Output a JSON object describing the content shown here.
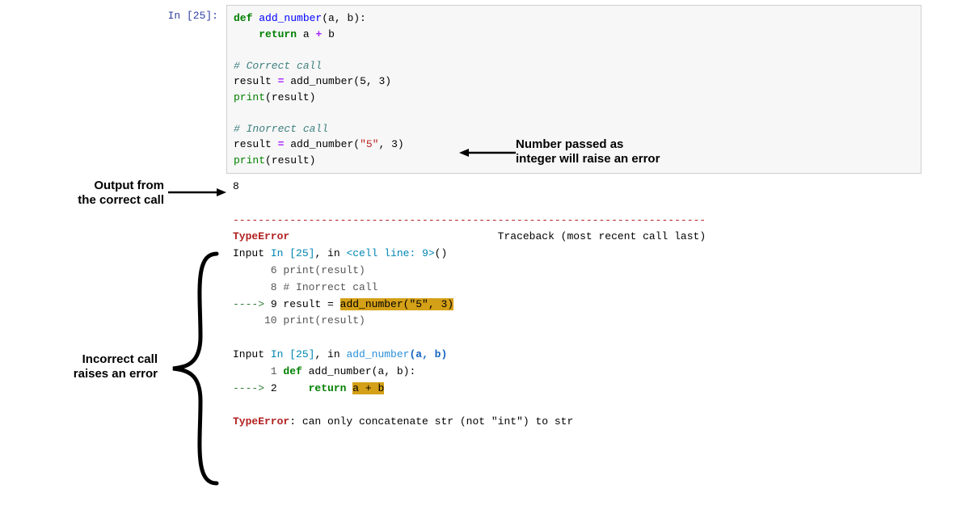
{
  "prompt": {
    "label": "In [25]:"
  },
  "code": {
    "def": "def",
    "func_name": "add_number",
    "params": "(a, b):",
    "return_kw": "return",
    "return_expr_a": "a",
    "return_op": "+",
    "return_expr_b": "b",
    "comment1": "# Correct call",
    "assign1": "result",
    "eq": "=",
    "call1_fn": "add_number",
    "call1_args": "(5, 3)",
    "print1": "print",
    "print1_args": "(result)",
    "comment2": "# Inorrect call",
    "assign2": "result",
    "call2_fn": "add_number",
    "call2_open": "(",
    "call2_str": "\"5\"",
    "call2_rest": ", 3)",
    "print2": "print",
    "print2_args": "(result)"
  },
  "output": {
    "correct_value": "8",
    "sep": "---------------------------------------------------------------------------",
    "err_type": "TypeError",
    "traceback_label": "Traceback (most recent call last)",
    "trace1_input": "Input",
    "trace1_in": "In [25]",
    "trace1_in_tail": ", in ",
    "trace1_loc": "<cell line: 9>",
    "trace1_loc_tail": "()",
    "l6": "      6 print(result)",
    "l8": "      8 # Inorrect call",
    "l9_arrow": "---->",
    "l9_num": " 9 ",
    "l9_text_pre": "result = ",
    "l9_hl": "add_number(\"5\", 3)",
    "l10": "     10 print(result)",
    "trace2_input": "Input",
    "trace2_in": "In [25]",
    "trace2_in_tail": ", in ",
    "trace2_func": "add_number",
    "trace2_args": "(a, b)",
    "d1_num": "      1 ",
    "d1_def": "def",
    "d1_name": " add_number(a, b):",
    "d2_arrow": "---->",
    "d2_num": " 2     ",
    "d2_return": "return",
    "d2_space": " ",
    "d2_hl": "a + b",
    "final_err": "TypeError",
    "final_msg": ": can only concatenate str (not \"int\") to str"
  },
  "annotations": {
    "right1": "Number passed as",
    "right2": "integer will raise an error",
    "left_output1": "Output from",
    "left_output2": "the correct call",
    "left_err1": "Incorrect call",
    "left_err2": "raises an error"
  }
}
